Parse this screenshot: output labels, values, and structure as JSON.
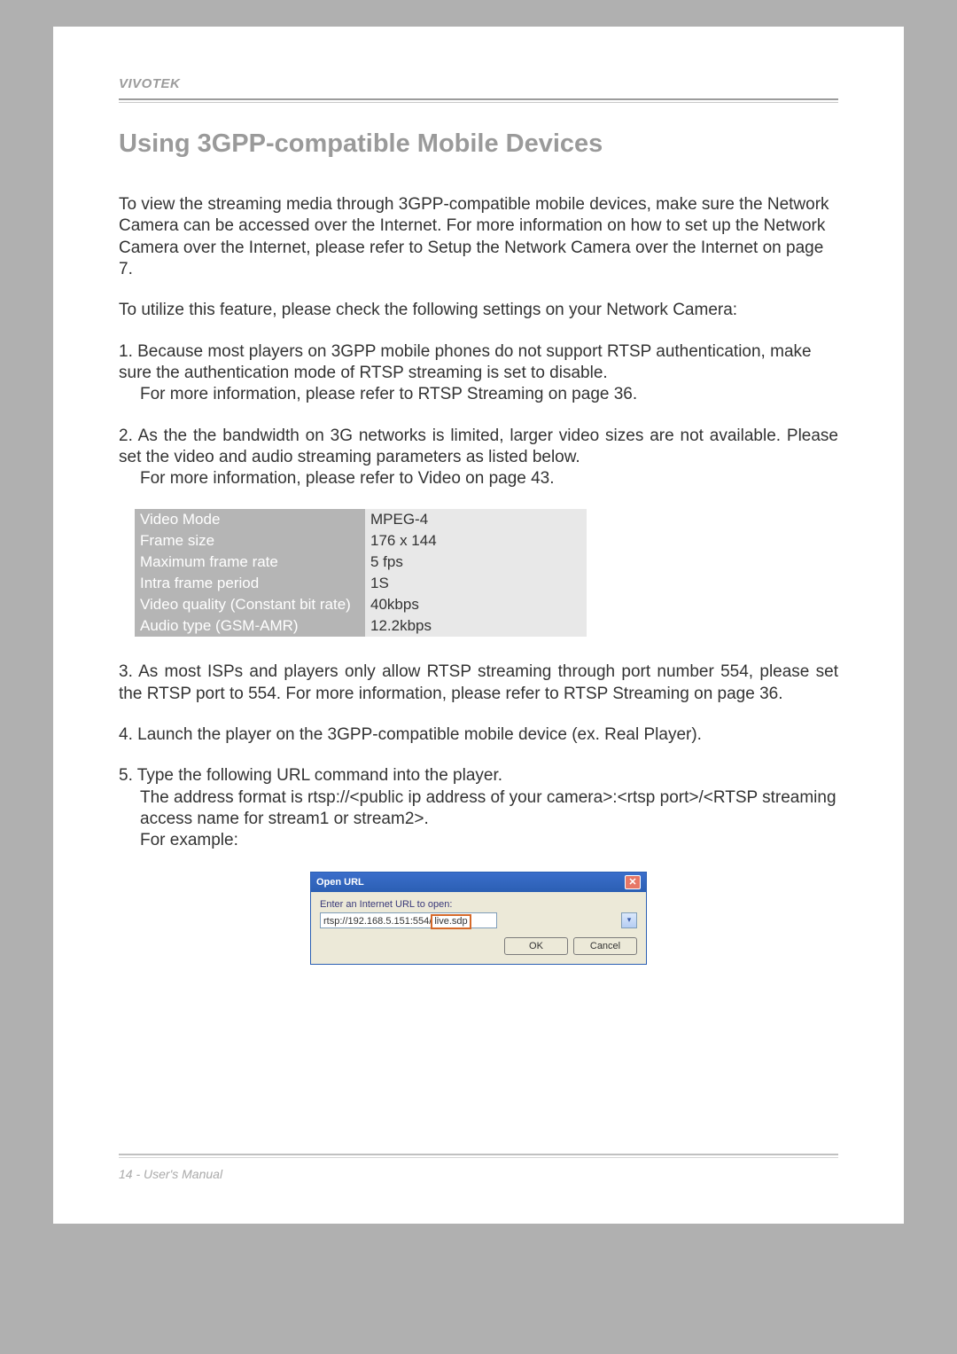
{
  "brand": "VIVOTEK",
  "footer": "14 - User's Manual",
  "heading": "Using 3GPP-compatible Mobile Devices",
  "intro": "To view the streaming media through 3GPP-compatible mobile devices, make sure the Network Camera can be accessed over the Internet. For more information on how to set up the Network Camera over the Internet, please refer to Setup the Network Camera over the Internet on page 7.",
  "lead": "To utilize this feature, please check the following settings on your Network Camera:",
  "items": {
    "1a": "Because most players on 3GPP mobile phones do not support RTSP authentication, make sure the authentication mode of RTSP streaming is set to disable.",
    "1b": "For more information, please refer to RTSP Streaming on page 36.",
    "2a": "As the the bandwidth on 3G networks is limited, larger video sizes are not available. Please set the video and audio streaming parameters as listed below.",
    "2b": "For more information, please refer to Video on page 43.",
    "3": "As most ISPs and players only allow RTSP streaming through port number 554, please set the RTSP port to 554. For more information, please refer to RTSP Streaming on page 36.",
    "4": "Launch the player on the 3GPP-compatible mobile device (ex. Real Player).",
    "5a": "Type the following URL command into the player.",
    "5b": "The address format is rtsp://<public ip address of your camera>:<rtsp port>/<RTSP streaming access name for stream1 or stream2>.",
    "5c": "For example:"
  },
  "table": [
    {
      "k": "Video Mode",
      "v": "MPEG-4"
    },
    {
      "k": "Frame size",
      "v": "176 x 144"
    },
    {
      "k": "Maximum frame rate",
      "v": "5 fps"
    },
    {
      "k": "Intra frame period",
      "v": "1S"
    },
    {
      "k": "Video quality (Constant bit rate)",
      "v": "40kbps"
    },
    {
      "k": "Audio type (GSM-AMR)",
      "v": "12.2kbps"
    }
  ],
  "dialog": {
    "title": "Open URL",
    "label": "Enter an Internet URL to open:",
    "url_prefix": "rtsp://192.168.5.151:554/",
    "url_highlight": "live.sdp",
    "ok": "OK",
    "cancel": "Cancel"
  }
}
